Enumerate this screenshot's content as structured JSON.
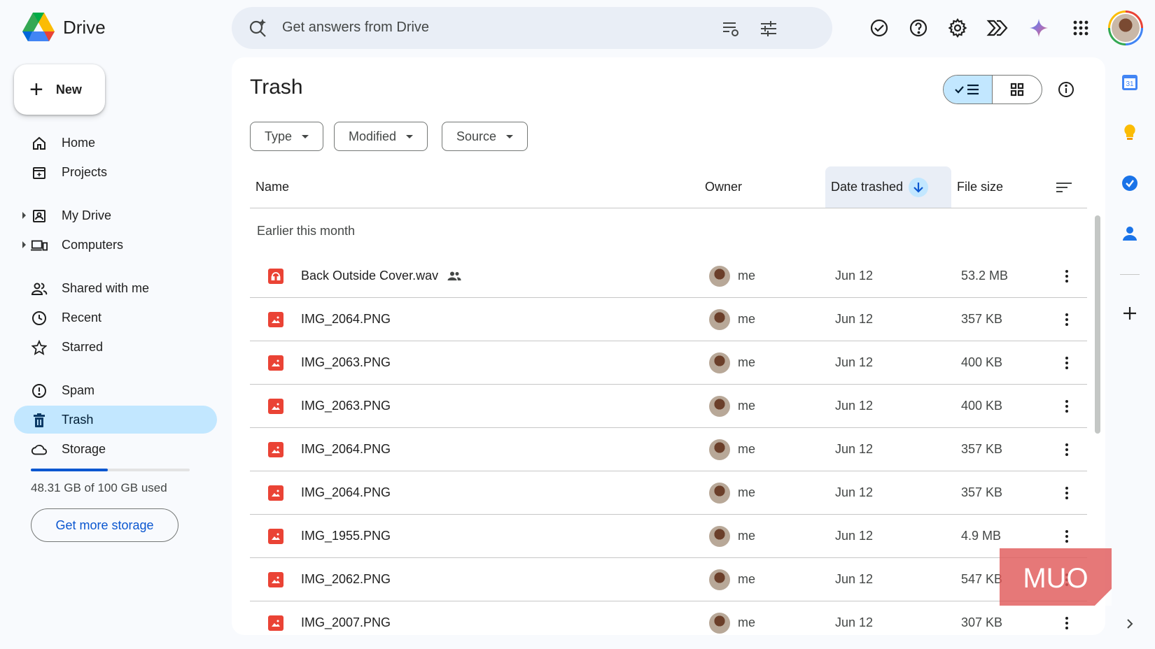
{
  "app": {
    "name": "Drive"
  },
  "search": {
    "placeholder": "Get answers from Drive"
  },
  "top_icons": [
    "ready-for-offline-icon",
    "help-icon",
    "settings-icon",
    "gemini-extensions-icon",
    "gemini-icon",
    "apps-grid-icon"
  ],
  "new_button": {
    "label": "New"
  },
  "nav": {
    "home": "Home",
    "projects": "Projects",
    "my_drive": "My Drive",
    "computers": "Computers",
    "shared": "Shared with me",
    "recent": "Recent",
    "starred": "Starred",
    "spam": "Spam",
    "trash": "Trash",
    "storage": "Storage"
  },
  "storage": {
    "used_text": "48.31 GB of 100 GB used",
    "used_fraction": 0.4831,
    "button": "Get more storage"
  },
  "page": {
    "title": "Trash"
  },
  "filters": {
    "type": "Type",
    "modified": "Modified",
    "source": "Source"
  },
  "columns": {
    "name": "Name",
    "owner": "Owner",
    "date": "Date trashed",
    "size": "File size"
  },
  "group": {
    "label": "Earlier this month"
  },
  "files": [
    {
      "name": "Back Outside Cover.wav",
      "owner": "me",
      "date": "Jun 12",
      "size": "53.2 MB",
      "icon": "audio-file-icon",
      "shared": true
    },
    {
      "name": "IMG_2064.PNG",
      "owner": "me",
      "date": "Jun 12",
      "size": "357 KB",
      "icon": "image-file-icon"
    },
    {
      "name": "IMG_2063.PNG",
      "owner": "me",
      "date": "Jun 12",
      "size": "400 KB",
      "icon": "image-file-icon"
    },
    {
      "name": "IMG_2063.PNG",
      "owner": "me",
      "date": "Jun 12",
      "size": "400 KB",
      "icon": "image-file-icon"
    },
    {
      "name": "IMG_2064.PNG",
      "owner": "me",
      "date": "Jun 12",
      "size": "357 KB",
      "icon": "image-file-icon"
    },
    {
      "name": "IMG_2064.PNG",
      "owner": "me",
      "date": "Jun 12",
      "size": "357 KB",
      "icon": "image-file-icon"
    },
    {
      "name": "IMG_1955.PNG",
      "owner": "me",
      "date": "Jun 12",
      "size": "4.9 MB",
      "icon": "image-file-icon"
    },
    {
      "name": "IMG_2062.PNG",
      "owner": "me",
      "date": "Jun 12",
      "size": "547 KB",
      "icon": "image-file-icon"
    },
    {
      "name": "IMG_2007.PNG",
      "owner": "me",
      "date": "Jun 12",
      "size": "307 KB",
      "icon": "image-file-icon"
    }
  ],
  "side_panel": {
    "calendar_day": "31"
  },
  "watermark": {
    "text": "MUO"
  },
  "colors": {
    "accent": "#0b57d0",
    "active_bg": "#c2e7ff",
    "file_red": "#ea4335",
    "search_bg": "#e9eef6"
  }
}
